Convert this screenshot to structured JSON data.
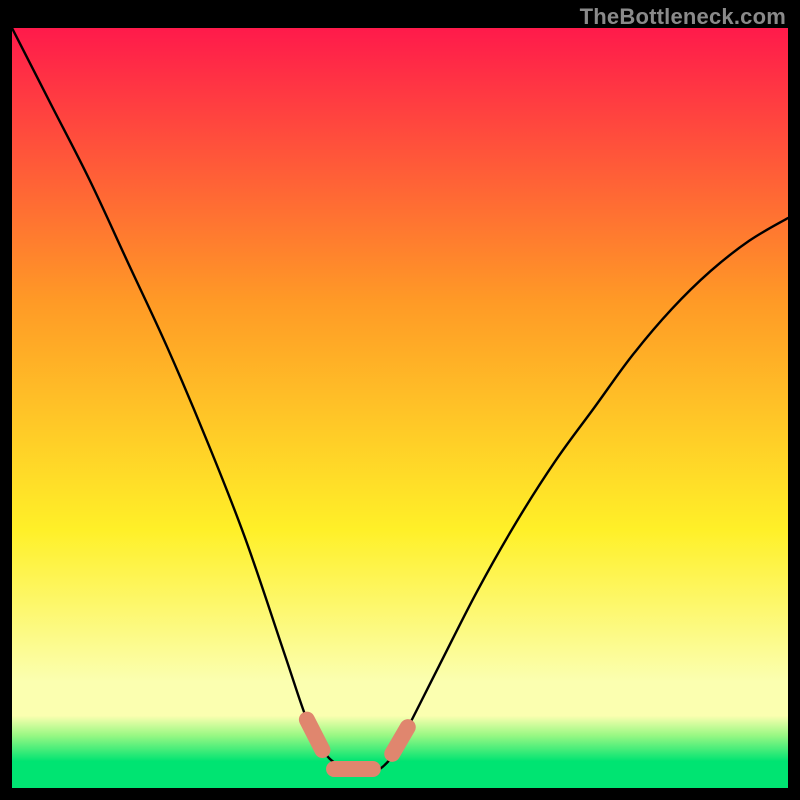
{
  "watermark": "TheBottleneck.com",
  "colors": {
    "top": "#ff1a4b",
    "mid_hi": "#ff9a26",
    "mid": "#fff028",
    "low": "#fbffb0",
    "green1": "#9cf884",
    "green2": "#00e472",
    "curve": "#000000",
    "marker_fill": "#e0866e",
    "marker_stroke": "#cf6f58"
  },
  "chart_data": {
    "type": "line",
    "title": "",
    "xlabel": "",
    "ylabel": "",
    "xlim": [
      0,
      100
    ],
    "ylim": [
      0,
      100
    ],
    "series": [
      {
        "name": "bottleneck-curve",
        "x": [
          0,
          5,
          10,
          15,
          20,
          25,
          30,
          35,
          38,
          40,
          42,
          44,
          46,
          48,
          50,
          55,
          60,
          65,
          70,
          75,
          80,
          85,
          90,
          95,
          100
        ],
        "y": [
          100,
          90,
          80,
          69,
          58,
          46,
          33,
          18,
          9,
          5,
          3,
          2,
          2,
          3,
          6,
          16,
          26,
          35,
          43,
          50,
          57,
          63,
          68,
          72,
          75
        ]
      }
    ],
    "markers": [
      {
        "name": "left-cap",
        "x0": 38.0,
        "y0": 9.0,
        "x1": 40.0,
        "y1": 5.0
      },
      {
        "name": "flat-seg",
        "x0": 41.5,
        "y0": 2.5,
        "x1": 46.5,
        "y1": 2.5
      },
      {
        "name": "right-cap",
        "x0": 49.0,
        "y0": 4.5,
        "x1": 51.0,
        "y1": 8.0
      }
    ]
  }
}
